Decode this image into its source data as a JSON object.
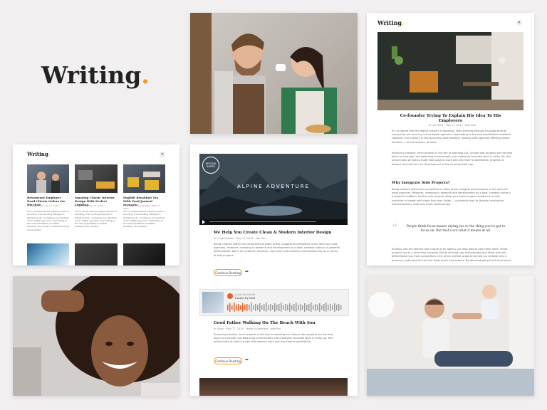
{
  "brand": {
    "name": "Writing",
    "dot": ".",
    "accent": "#f39a1e"
  },
  "left_card": {
    "logo": "Writing",
    "close": "✕",
    "posts": [
      {
        "title": "Restaurant Employer Read Clients Orders On His iPad",
        "meta": "In Images, Blog · Dec 9, 2019",
        "excerpt": "It's no secret that the digital industry is booming. From exciting startups to global brands, companies are reaching out to digital agencies, responding to the new possibilities available. However, the industry is fast becoming overcrowded."
      },
      {
        "title": "Amazing Classic Interior Design With Perfect Lighting",
        "meta": "In Art Style · May 17, 2019",
        "excerpt": "It's no secret that the digital industry is booming. From exciting startups to global brands, companies are reaching out to digital agencies, responding to the new possibilities available. However, the industry."
      },
      {
        "title": "English Breakfast Tea With Food Journal Scenario",
        "meta": "In Art Style, Photography · May 17, 2019",
        "excerpt": "It's no secret that the digital industry is booming. From exciting startups to global brands, companies are reaching out to digital agencies, responding to the new possibilities available. However, the industry."
      }
    ]
  },
  "middle_card": {
    "video_badge": "BEYOND NORTH",
    "video_title": "ALPINE ADVENTURE",
    "post1": {
      "title": "We Help You Create Clean & Modern Interior Design",
      "meta": "In Images/Video · May 17, 2019 · Jake Kim",
      "excerpt": "Being creative within the constraints of client briefs, budgets and timelines is the norm for most agencies. However, investing in research and development as a boat, creative outlet is a powerful differentiator. We're all creatives. However, over time and business, the business we do in terms of side projects.",
      "button": "Continue Reading"
    },
    "audio": {
      "artist": "Audio Sound Art",
      "track": "Escape My Mind"
    },
    "post2": {
      "title": "Good Father Walking On The Beach With Son",
      "meta": "In Audio · May 17, 2019 · Leave a comment · Jake Kim",
      "excerpt": "Producing creative, fresh projects is the key to avoiding our Unique side projects are the best place to innovate, but balancing commercially and creatively focussed work is tricky. So, this article looks at how to make side projects work and why they're worthwhile.",
      "button": "Continue Reading"
    }
  },
  "right_card": {
    "logo": "Writing",
    "close": "✕",
    "title": "Co-founder Trying To Explain His Idea To His Employers",
    "meta": "In Life Style · May 17, 2019 · Jake Kim",
    "para1": "It's no secret that the digital industry is booming. From exciting startups to global brands, companies are reaching out to digital agencies, responding to the new possibilities available. However, the industry is fast becoming overcrowded, heaving with agencies offering similar services — on the surface, at least.",
    "para2": "Producing creative, fresh projects is the key to standing out. Unique side projects are the best place to innovate, but balancing commercially and creatively focussed work is tricky. So, this article looks at how to make side projects work and why they're worthwhile, drawing on lessons learned from our development of the accompanied app.",
    "subheading": "Why Integrate Side Projects?",
    "para3": "Being creative within the constraints of client briefs, budgets and timelines is the norm for most agencies. However, investing in research and development as a boat, creative outlet is a powerful addition. Further side projects allow your team to gain confidence in their expertise in ideate and shape their own vision — a powerful way to develop motivation, interdisciplinary skills and client relationships.",
    "quote": "People think focus means saying yes to the thing you've got to focus on. But that's not what it means at all.",
    "para4": "Building into the identity and culture of an agency can also lead to new client work. These projects act as a road map, showing clients exciting new technologies and ideas that will differentiate you from competitors. One of our earliest projects formed our website into a brochure, optimised for the first iPads touch interactions. By demonstrating the final product,"
  }
}
